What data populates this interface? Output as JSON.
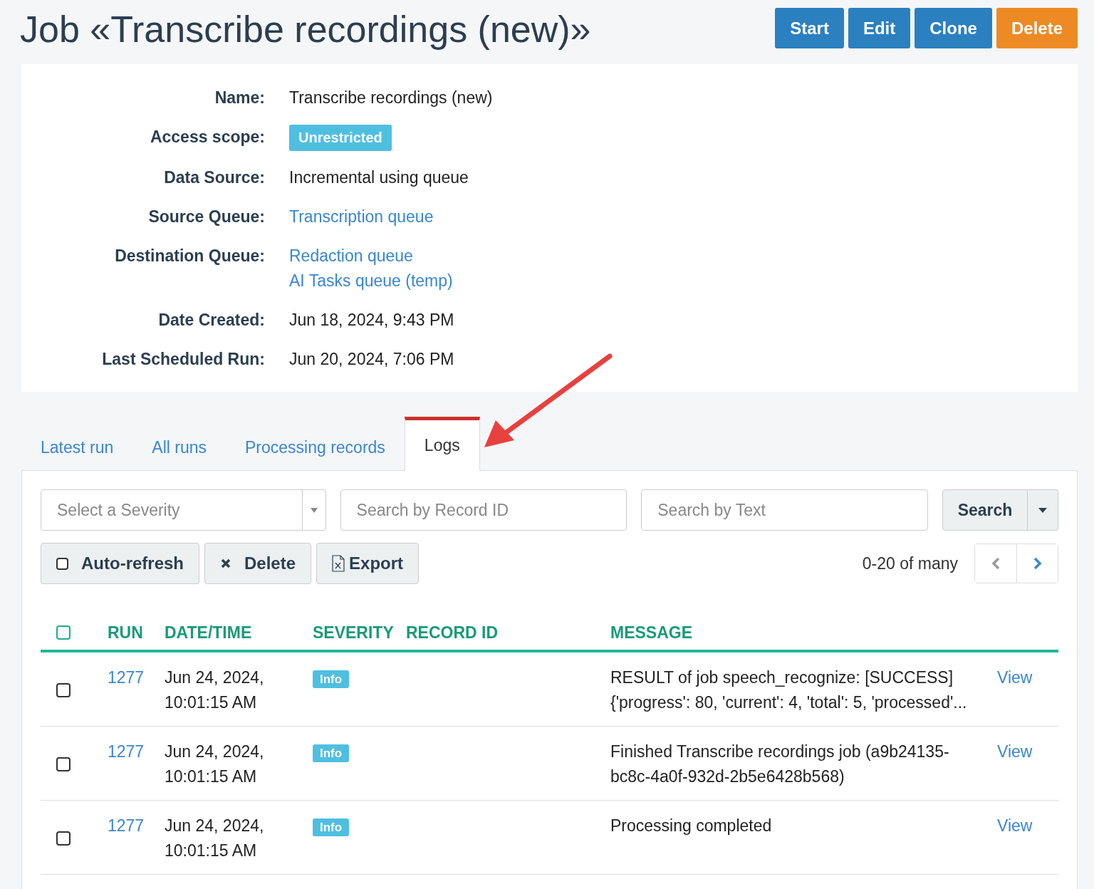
{
  "title": "Job «Transcribe recordings (new)»",
  "actions": [
    {
      "label": "Start",
      "kind": "primary"
    },
    {
      "label": "Edit",
      "kind": "primary"
    },
    {
      "label": "Clone",
      "kind": "primary"
    },
    {
      "label": "Delete",
      "kind": "danger"
    }
  ],
  "details": [
    {
      "label": "Name:",
      "kind": "text",
      "values": [
        "Transcribe recordings (new)"
      ]
    },
    {
      "label": "Access scope:",
      "kind": "badge",
      "values": [
        "Unrestricted"
      ]
    },
    {
      "label": "Data Source:",
      "kind": "text",
      "values": [
        "Incremental using queue"
      ]
    },
    {
      "label": "Source Queue:",
      "kind": "link",
      "values": [
        "Transcription queue"
      ]
    },
    {
      "label": "Destination Queue:",
      "kind": "link",
      "values": [
        "Redaction queue",
        "AI Tasks queue (temp)"
      ]
    },
    {
      "label": "Date Created:",
      "kind": "text",
      "values": [
        "Jun 18, 2024, 9:43 PM"
      ]
    },
    {
      "label": "Last Scheduled Run:",
      "kind": "text",
      "values": [
        "Jun 20, 2024, 7:06 PM"
      ]
    }
  ],
  "tabs": [
    {
      "label": "Latest run",
      "selected": false
    },
    {
      "label": "All runs",
      "selected": false
    },
    {
      "label": "Processing records",
      "selected": false
    },
    {
      "label": "Logs",
      "selected": true
    }
  ],
  "filters": {
    "severity": {
      "placeholder": "Select a Severity"
    },
    "record_id": {
      "placeholder": "Search by Record ID"
    },
    "text": {
      "placeholder": "Search by Text"
    },
    "search_button": "Search"
  },
  "toolbar": {
    "auto_refresh": {
      "label": "Auto-refresh",
      "checked": false
    },
    "delete": "Delete",
    "export": "Export",
    "pagination": "0-20 of many"
  },
  "table": {
    "select_all": {
      "checked": false
    },
    "columns": [
      "RUN",
      "DATE/TIME",
      "SEVERITY",
      "RECORD ID",
      "MESSAGE"
    ],
    "rows": [
      {
        "checked": false,
        "run": "1277",
        "datetime": [
          "Jun 24, 2024,",
          "10:01:15 AM"
        ],
        "severity": "Info",
        "message": [
          "RESULT of job speech_recognize: [SUCCESS]",
          "{'progress': 80, 'current': 4, 'total': 5, 'processed'..."
        ],
        "action": "View"
      },
      {
        "checked": false,
        "run": "1277",
        "datetime": [
          "Jun 24, 2024,",
          "10:01:15 AM"
        ],
        "severity": "Info",
        "message": [
          "Finished Transcribe recordings job (a9b24135-",
          "bc8c-4a0f-932d-2b5e6428b568)"
        ],
        "action": "View"
      },
      {
        "checked": false,
        "run": "1277",
        "datetime": [
          "Jun 24, 2024,",
          "10:01:15 AM"
        ],
        "severity": "Info",
        "message": [
          "Processing completed"
        ],
        "action": "View"
      }
    ]
  }
}
